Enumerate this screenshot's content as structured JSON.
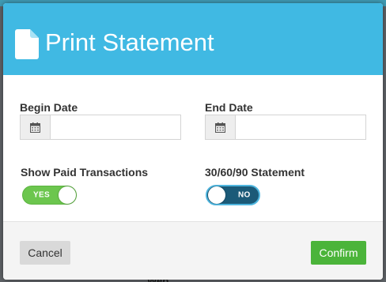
{
  "background": {
    "partial_text": "Web"
  },
  "modal": {
    "title": "Print Statement",
    "icon": "document-icon",
    "fields": {
      "begin_date": {
        "label": "Begin Date",
        "value": "",
        "placeholder": "",
        "icon": "calendar-icon"
      },
      "end_date": {
        "label": "End Date",
        "value": "",
        "placeholder": "",
        "icon": "calendar-icon"
      }
    },
    "toggles": {
      "show_paid": {
        "label": "Show Paid Transactions",
        "state_text": "YES",
        "on": true
      },
      "statement_306090": {
        "label": "30/60/90 Statement",
        "state_text": "NO",
        "on": false
      }
    },
    "footer": {
      "cancel_label": "Cancel",
      "confirm_label": "Confirm"
    }
  },
  "colors": {
    "header": "#40b9e3",
    "toggle_on": "#6cc64e",
    "toggle_off": "#1b5a78",
    "confirm": "#4bb43a",
    "cancel": "#d9d9d9"
  }
}
